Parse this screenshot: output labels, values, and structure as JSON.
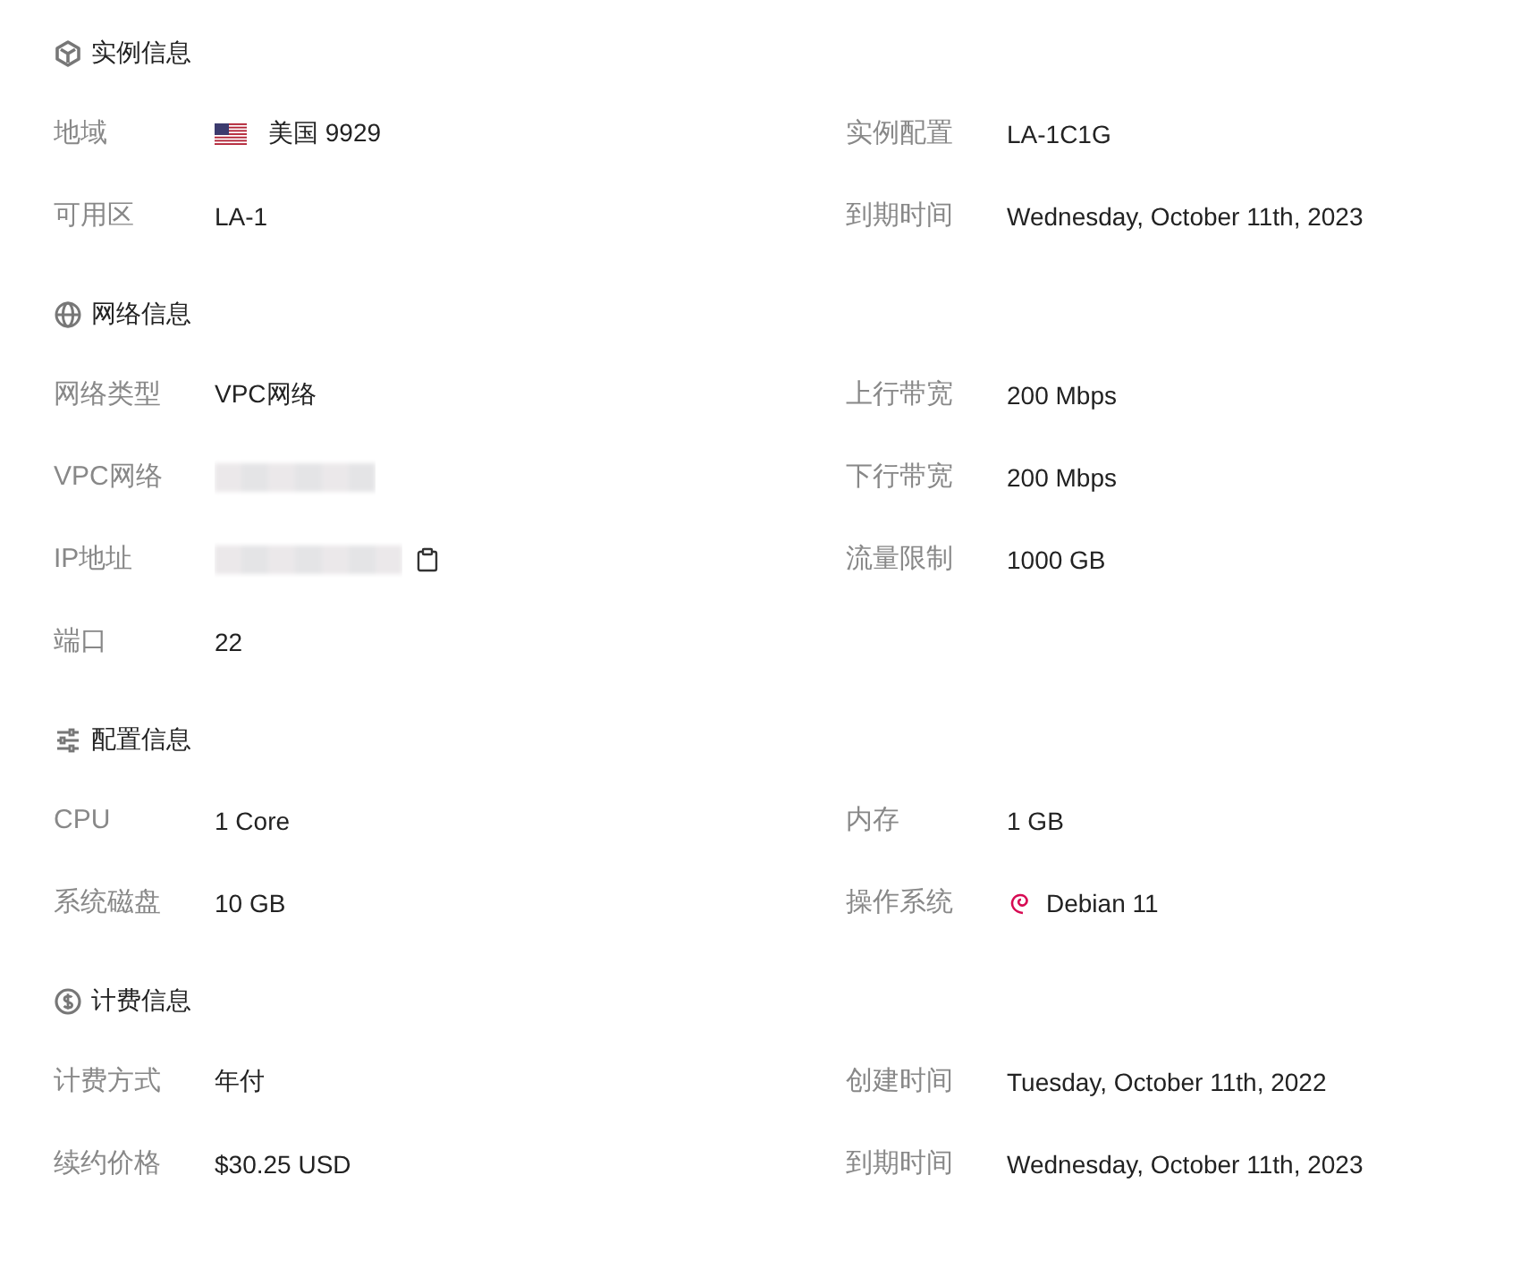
{
  "sections": [
    {
      "title": "实例信息",
      "rows": [
        {
          "left": {
            "label": "地域",
            "kind": "flag",
            "value": "美国 9929"
          },
          "right": {
            "label": "实例配置",
            "kind": "text",
            "value": "LA-1C1G"
          }
        },
        {
          "left": {
            "label": "可用区",
            "kind": "text",
            "value": "LA-1"
          },
          "right": {
            "label": "到期时间",
            "kind": "text",
            "value": "Wednesday, October 11th, 2023"
          }
        }
      ]
    },
    {
      "title": "网络信息",
      "rows": [
        {
          "left": {
            "label": "网络类型",
            "kind": "text",
            "value": "VPC网络"
          },
          "right": {
            "label": "上行带宽",
            "kind": "text",
            "value": "200 Mbps"
          }
        },
        {
          "left": {
            "label": "VPC网络",
            "kind": "redacted",
            "copyable": false
          },
          "right": {
            "label": "下行带宽",
            "kind": "text",
            "value": "200 Mbps"
          }
        },
        {
          "left": {
            "label": "IP地址",
            "kind": "redacted",
            "copyable": true
          },
          "right": {
            "label": "流量限制",
            "kind": "text",
            "value": "1000 GB"
          }
        },
        {
          "left": {
            "label": "端口",
            "kind": "text",
            "value": "22"
          }
        }
      ]
    },
    {
      "title": "配置信息",
      "rows": [
        {
          "left": {
            "label": "CPU",
            "kind": "text",
            "value": "1 Core"
          },
          "right": {
            "label": "内存",
            "kind": "text",
            "value": "1 GB"
          }
        },
        {
          "left": {
            "label": "系统磁盘",
            "kind": "text",
            "value": "10 GB"
          },
          "right": {
            "label": "操作系统",
            "kind": "os",
            "value": "Debian 11"
          }
        }
      ]
    },
    {
      "title": "计费信息",
      "rows": [
        {
          "left": {
            "label": "计费方式",
            "kind": "text",
            "value": "年付"
          },
          "right": {
            "label": "创建时间",
            "kind": "text",
            "value": "Tuesday, October 11th, 2022"
          }
        },
        {
          "left": {
            "label": "续约价格",
            "kind": "text",
            "value": "$30.25 USD"
          },
          "right": {
            "label": "到期时间",
            "kind": "text",
            "value": "Wednesday, October 11th, 2023"
          }
        }
      ]
    }
  ]
}
